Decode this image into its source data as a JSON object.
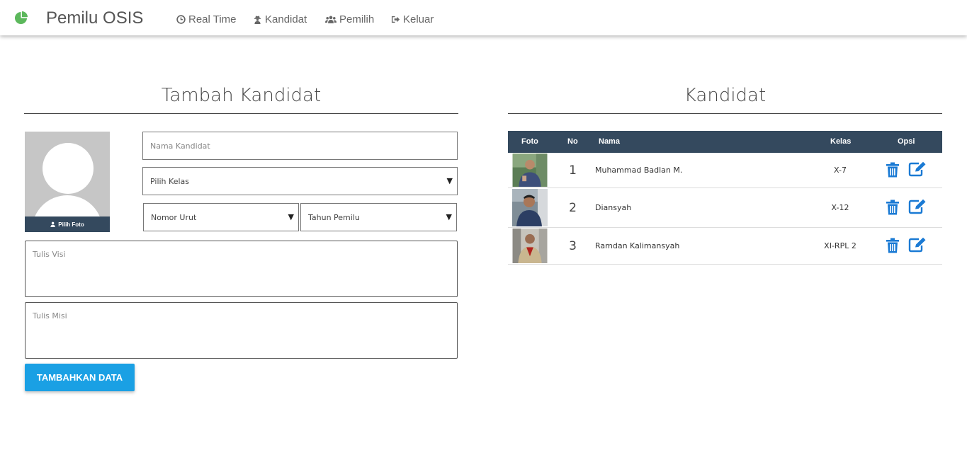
{
  "navbar": {
    "brand_icon": "pie-chart-icon",
    "brand_title": "Pemilu OSIS",
    "accent_color": "#5cb85c",
    "items": [
      {
        "label": "Real Time",
        "icon": "clock-icon"
      },
      {
        "label": "Kandidat",
        "icon": "user-secret-icon"
      },
      {
        "label": "Pemilih",
        "icon": "users-icon"
      },
      {
        "label": "Keluar",
        "icon": "sign-out-icon"
      }
    ]
  },
  "form": {
    "title": "Tambah Kandidat",
    "photo_button": "Pilih Foto",
    "nama_placeholder": "Nama Kandidat",
    "kelas_select": "Pilih Kelas",
    "nomor_select": "Nomor Urut",
    "tahun_select": "Tahun Pemilu",
    "visi_placeholder": "Tulis Visi",
    "misi_placeholder": "Tulis Misi",
    "submit_label": "TAMBAHKAN DATA",
    "button_color": "#1aa0e4"
  },
  "table": {
    "title": "Kandidat",
    "header_color": "#34495e",
    "columns": [
      "Foto",
      "No",
      "Nama",
      "Kelas",
      "Opsi"
    ],
    "rows": [
      {
        "no": "1",
        "nama": "Muhammad Badlan M.",
        "kelas": "X-7"
      },
      {
        "no": "2",
        "nama": "Diansyah",
        "kelas": "X-12"
      },
      {
        "no": "3",
        "nama": "Ramdan Kalimansyah",
        "kelas": "XI-RPL 2"
      }
    ],
    "action_icons": [
      "trash-icon",
      "edit-icon"
    ],
    "action_color": "#1a7ad4"
  }
}
